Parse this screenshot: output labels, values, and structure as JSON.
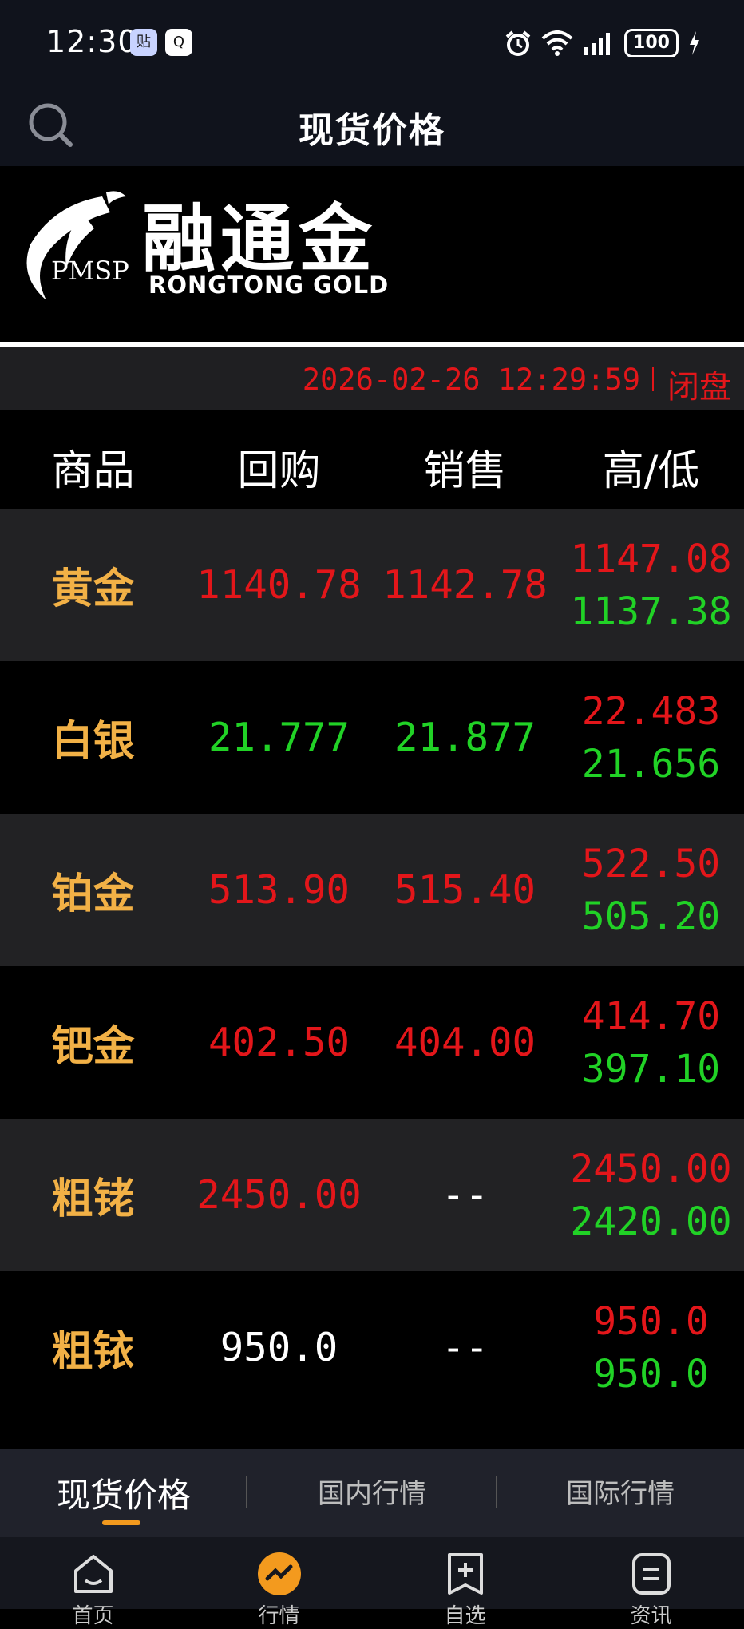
{
  "status_bar": {
    "time": "12:30",
    "battery": "100",
    "app_icons": [
      "贴",
      "Q"
    ]
  },
  "header": {
    "title": "现货价格",
    "search_icon": "search-icon"
  },
  "banner": {
    "logo_cn": "融通金",
    "logo_en": "RONGTONG GOLD",
    "logo_badge": "PMSP"
  },
  "quote_meta": {
    "timestamp": "2026-02-26 12:29:59",
    "market_status": "闭盘"
  },
  "table": {
    "headers": [
      "商品",
      "回购",
      "销售",
      "高/低"
    ],
    "rows": [
      {
        "name": "黄金",
        "buyback": "1140.78",
        "sell": "1142.78",
        "high": "1147.08",
        "low": "1137.38"
      },
      {
        "name": "白银",
        "buyback": "21.777",
        "sell": "21.877",
        "high": "22.483",
        "low": "21.656"
      },
      {
        "name": "铂金",
        "buyback": "513.90",
        "sell": "515.40",
        "high": "522.50",
        "low": "505.20"
      },
      {
        "name": "钯金",
        "buyback": "402.50",
        "sell": "404.00",
        "high": "414.70",
        "low": "397.10"
      },
      {
        "name": "粗铑",
        "buyback": "2450.00",
        "sell": "--",
        "high": "2450.00",
        "low": "2420.00"
      },
      {
        "name": "粗铱",
        "buyback": "950.0",
        "sell": "--",
        "high": "950.0",
        "low": "950.0"
      }
    ]
  },
  "sub_tabs": [
    "现货价格",
    "国内行情",
    "国际行情"
  ],
  "bottom_nav": [
    "首页",
    "行情",
    "自选",
    "资讯"
  ],
  "colors": {
    "up": "#e3161a",
    "down": "#21d226",
    "product_name": "#f2b146",
    "accent": "#f39a1e"
  }
}
